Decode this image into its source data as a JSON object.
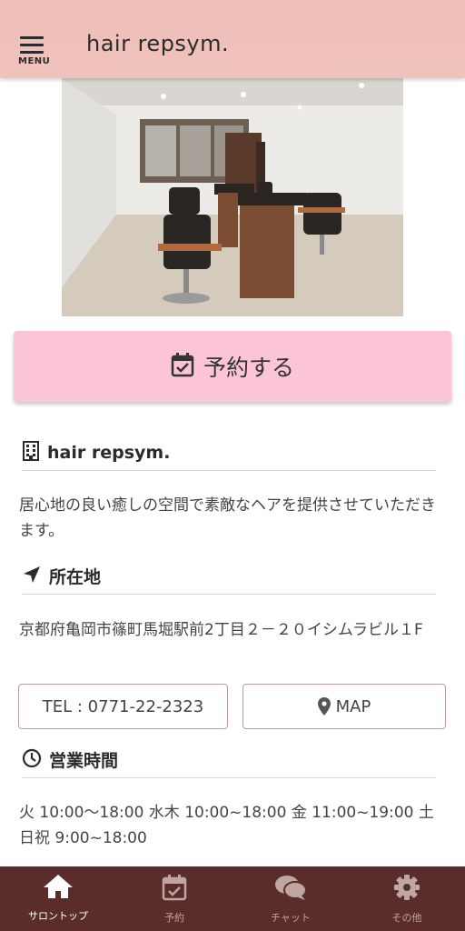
{
  "header": {
    "menu_label": "MENU",
    "title": "hair repsym."
  },
  "reserve": {
    "label": "予約する"
  },
  "salon": {
    "name": "hair repsym.",
    "description": "居心地の良い癒しの空間で素敵なヘアを提供させていただきます。"
  },
  "location": {
    "heading": "所在地",
    "address": "京都府亀岡市篠町馬堀駅前2丁目２－２０イシムラビル１F",
    "tel_label": "TEL : 0771-22-2323",
    "map_label": "MAP"
  },
  "hours": {
    "heading": "営業時間",
    "text": "火 10:00〜18:00 水木 10:00~18:00 金 11:00~19:00 土日祝 9:00~18:00"
  },
  "nav": {
    "items": [
      {
        "label": "サロントップ",
        "icon": "home-icon"
      },
      {
        "label": "予約",
        "icon": "calendar-check-icon"
      },
      {
        "label": "チャット",
        "icon": "chat-icon"
      },
      {
        "label": "その他",
        "icon": "gear-icon"
      }
    ]
  },
  "colors": {
    "header": "#f0c2bc",
    "reserve": "#fbc5d6",
    "nav": "#5a2d2a"
  }
}
